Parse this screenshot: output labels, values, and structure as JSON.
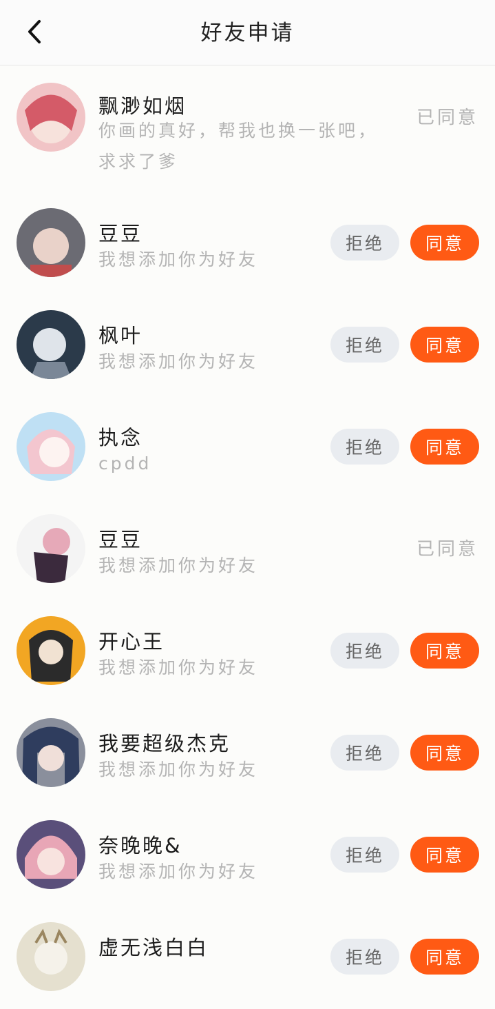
{
  "header": {
    "title": "好友申请",
    "back_icon": "back-arrow-icon"
  },
  "requests": [
    {
      "name": "飘渺如烟",
      "message": "你画的真好，帮我也换一张吧，求求了爹",
      "status": "已同意",
      "avatar_palette": [
        "#f1c4c6",
        "#d45b68",
        "#f7e2dc"
      ]
    },
    {
      "name": "豆豆",
      "message": "我想添加你为好友",
      "reject_label": "拒绝",
      "accept_label": "同意",
      "avatar_palette": [
        "#6b6b73",
        "#e9d2c9",
        "#c04d4d"
      ]
    },
    {
      "name": "枫叶",
      "message": "我想添加你为好友",
      "reject_label": "拒绝",
      "accept_label": "同意",
      "avatar_palette": [
        "#2b3a4a",
        "#dfe4ea",
        "#7a8797"
      ]
    },
    {
      "name": "执念",
      "message": "cpdd",
      "reject_label": "拒绝",
      "accept_label": "同意",
      "avatar_palette": [
        "#f3c6cf",
        "#bfe0f4",
        "#fdf3f1"
      ]
    },
    {
      "name": "豆豆",
      "message": "我想添加你为好友",
      "status": "已同意",
      "avatar_palette": [
        "#f4f4f4",
        "#e6a9b8",
        "#3b2a3d"
      ]
    },
    {
      "name": "开心王",
      "message": "我想添加你为好友",
      "reject_label": "拒绝",
      "accept_label": "同意",
      "avatar_palette": [
        "#f2a623",
        "#2b2b2b",
        "#f1e2d2"
      ]
    },
    {
      "name": "我要超级杰克",
      "message": "我想添加你为好友",
      "reject_label": "拒绝",
      "accept_label": "同意",
      "avatar_palette": [
        "#2f3d5e",
        "#f0dfd9",
        "#8a8f9c"
      ]
    },
    {
      "name": "奈晚晚&",
      "message": "我想添加你为好友",
      "reject_label": "拒绝",
      "accept_label": "同意",
      "avatar_palette": [
        "#e8a6b6",
        "#5a4f7a",
        "#f8e3df"
      ]
    },
    {
      "name": "虚无浅白白",
      "message": "",
      "reject_label": "拒绝",
      "accept_label": "同意",
      "avatar_palette": [
        "#e5e0cf",
        "#b9a47a",
        "#f5f2ea"
      ]
    }
  ]
}
